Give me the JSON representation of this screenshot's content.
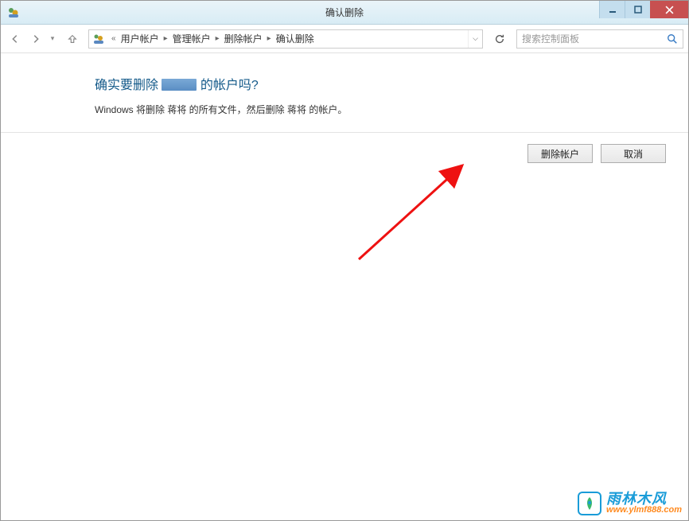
{
  "window": {
    "title": "确认删除"
  },
  "breadcrumb": {
    "prefix": "«",
    "items": [
      "用户帐户",
      "管理帐户",
      "删除帐户",
      "确认删除"
    ]
  },
  "search": {
    "placeholder": "搜索控制面板"
  },
  "main": {
    "heading_prefix": "确实要删除",
    "heading_suffix": "的帐户吗?",
    "description": "Windows 将删除 蒋将 的所有文件，然后删除 蒋将 的帐户。"
  },
  "actions": {
    "delete_label": "删除帐户",
    "cancel_label": "取消"
  },
  "watermark": {
    "name": "雨林木风",
    "url": "www.ylmf888.com"
  }
}
